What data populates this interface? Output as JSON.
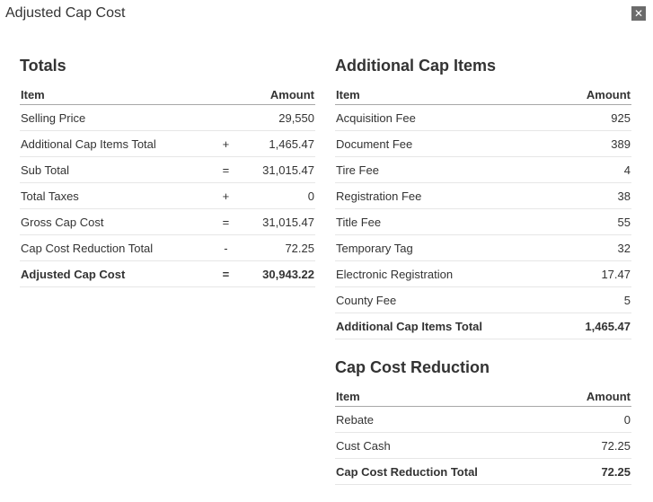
{
  "dialog": {
    "title": "Adjusted Cap Cost",
    "close_label": "✕"
  },
  "totals": {
    "title": "Totals",
    "headers": {
      "item": "Item",
      "amount": "Amount"
    },
    "rows": [
      {
        "label": "Selling Price",
        "op": "",
        "amount": "29,550"
      },
      {
        "label": "Additional Cap Items Total",
        "op": "+",
        "amount": "1,465.47"
      },
      {
        "label": "Sub Total",
        "op": "=",
        "amount": "31,015.47"
      },
      {
        "label": "Total Taxes",
        "op": "+",
        "amount": "0"
      },
      {
        "label": "Gross Cap Cost",
        "op": "=",
        "amount": "31,015.47"
      },
      {
        "label": "Cap Cost Reduction Total",
        "op": "-",
        "amount": "72.25"
      }
    ],
    "total": {
      "label": "Adjusted Cap Cost",
      "op": "=",
      "amount": "30,943.22"
    }
  },
  "additional_cap_items": {
    "title": "Additional Cap Items",
    "headers": {
      "item": "Item",
      "amount": "Amount"
    },
    "rows": [
      {
        "label": "Acquisition Fee",
        "amount": "925"
      },
      {
        "label": "Document Fee",
        "amount": "389"
      },
      {
        "label": "Tire Fee",
        "amount": "4"
      },
      {
        "label": "Registration Fee",
        "amount": "38"
      },
      {
        "label": "Title Fee",
        "amount": "55"
      },
      {
        "label": "Temporary Tag",
        "amount": "32"
      },
      {
        "label": "Electronic Registration",
        "amount": "17.47"
      },
      {
        "label": "County Fee",
        "amount": "5"
      }
    ],
    "total": {
      "label": "Additional Cap Items Total",
      "amount": "1,465.47"
    }
  },
  "cap_cost_reduction": {
    "title": "Cap Cost Reduction",
    "headers": {
      "item": "Item",
      "amount": "Amount"
    },
    "rows": [
      {
        "label": "Rebate",
        "amount": "0"
      },
      {
        "label": "Cust Cash",
        "amount": "72.25"
      }
    ],
    "total": {
      "label": "Cap Cost Reduction Total",
      "amount": "72.25"
    }
  }
}
